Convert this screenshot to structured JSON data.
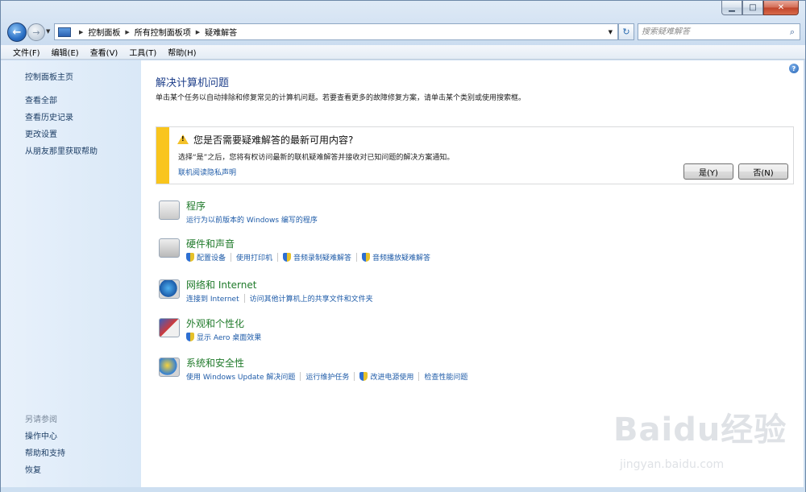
{
  "window": {
    "caption_min": "▁",
    "caption_max": "□",
    "caption_close": "✕"
  },
  "address_bar": {
    "crumbs": [
      "控制面板",
      "所有控制面板项",
      "疑难解答"
    ],
    "search_placeholder": "搜索疑难解答"
  },
  "menu": [
    "文件(F)",
    "编辑(E)",
    "查看(V)",
    "工具(T)",
    "帮助(H)"
  ],
  "sidebar": {
    "home": "控制面板主页",
    "links": [
      "查看全部",
      "查看历史记录",
      "更改设置",
      "从朋友那里获取帮助"
    ],
    "see_also_title": "另请参阅",
    "see_also": [
      "操作中心",
      "帮助和支持",
      "恢复"
    ]
  },
  "main": {
    "title": "解决计算机问题",
    "description": "单击某个任务以自动排除和修复常见的计算机问题。若要查看更多的故障修复方案，请单击某个类别或使用搜索框。",
    "notice": {
      "title": "您是否需要疑难解答的最新可用内容?",
      "text": "选择“是”之后，您将有权访问最新的联机疑难解答并接收对已知问题的解决方案通知。",
      "privacy_link": "联机阅读隐私声明",
      "yes": "是(Y)",
      "no": "否(N)"
    },
    "categories": [
      {
        "name": "程序",
        "icon": "programs-icon",
        "links": [
          "运行为以前版本的 Windows 编写的程序"
        ]
      },
      {
        "name": "硬件和声音",
        "icon": "hardware-icon",
        "links": [
          "配置设备",
          "使用打印机",
          "音频录制疑难解答",
          "音频播放疑难解答"
        ]
      },
      {
        "name": "网络和 Internet",
        "icon": "network-icon",
        "links": [
          "连接到 Internet",
          "访问其他计算机上的共享文件和文件夹"
        ]
      },
      {
        "name": "外观和个性化",
        "icon": "appearance-icon",
        "links": [
          "显示 Aero 桌面效果"
        ]
      },
      {
        "name": "系统和安全性",
        "icon": "security-icon",
        "links": [
          "使用 Windows Update 解决问题",
          "运行维护任务",
          "改进电源使用",
          "检查性能问题"
        ]
      }
    ]
  },
  "watermark": {
    "main": "Baidu经验",
    "sub": "jingyan.baidu.com"
  }
}
